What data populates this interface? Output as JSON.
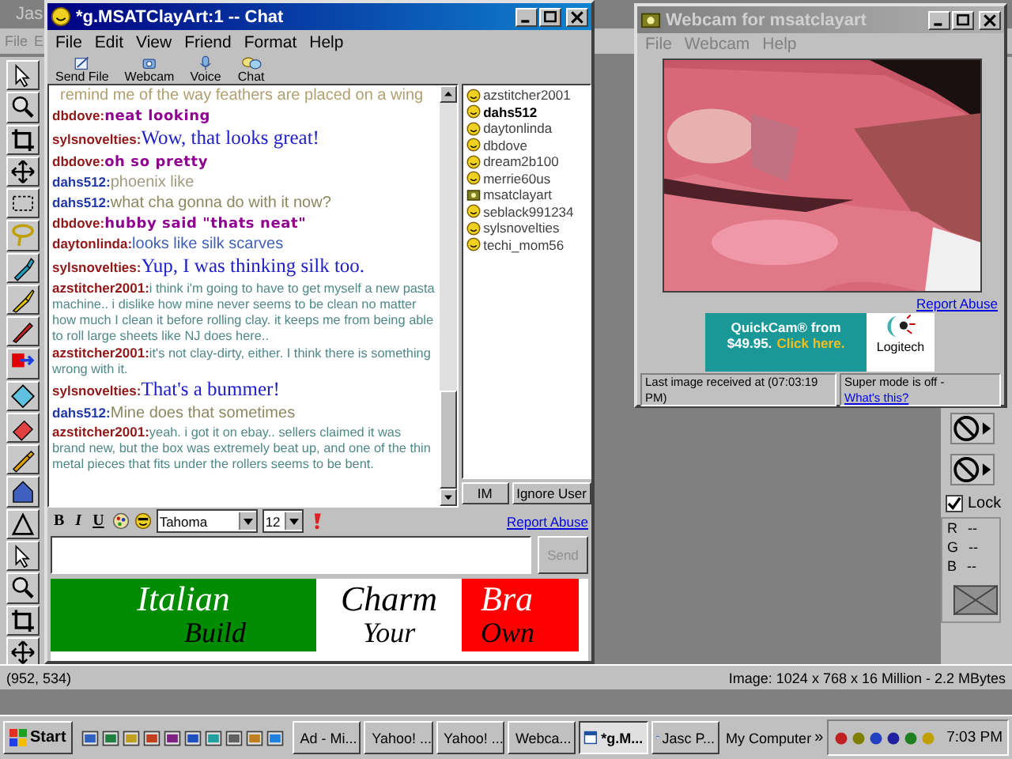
{
  "app": {
    "title": "Jas",
    "menu": [
      "File",
      "E"
    ]
  },
  "chat_window": {
    "title": "*g.MSATClayArt:1 -- Chat",
    "active": true,
    "menu": [
      "File",
      "Edit",
      "View",
      "Friend",
      "Format",
      "Help"
    ],
    "toolbar": [
      {
        "label": "Send File",
        "kind": "send-file"
      },
      {
        "label": "Webcam",
        "kind": "webcam"
      },
      {
        "label": "Voice",
        "kind": "voice"
      },
      {
        "label": "Chat",
        "kind": "chat"
      }
    ],
    "messages": [
      {
        "text": "remind me of the way feathers are placed on a wing",
        "kind": "sans",
        "color": "#b0a070"
      },
      {
        "sender": {
          "text": "dbdove:",
          "color": "#901818"
        },
        "text": "neat looking",
        "kind": "heavy",
        "color": "#900090"
      },
      {
        "sender": {
          "text": "sylsnovelties:",
          "color": "#901818"
        },
        "text": "Wow, that looks great!",
        "kind": "serif",
        "color": "#2020c8"
      },
      {
        "sender": {
          "text": "dbdove:",
          "color": "#901818"
        },
        "text": "oh so pretty",
        "kind": "heavy",
        "color": "#900090"
      },
      {
        "sender": {
          "text": "dahs512:",
          "color": "#2038a8"
        },
        "text": "phoenix like",
        "kind": "sans",
        "color": "#a09c80"
      },
      {
        "sender": {
          "text": "dahs512:",
          "color": "#2038a8"
        },
        "text": "what cha gonna do with it now?",
        "kind": "sans",
        "color": "#8c8860"
      },
      {
        "sender": {
          "text": "dbdove:",
          "color": "#901818"
        },
        "text": "hubby said \"thats neat\"",
        "kind": "heavy",
        "color": "#900090"
      },
      {
        "sender": {
          "text": "daytonlinda:",
          "color": "#901818"
        },
        "text": "looks like silk scarves",
        "kind": "sans",
        "color": "#4060b8"
      },
      {
        "sender": {
          "text": "sylsnovelties:",
          "color": "#901818"
        },
        "text": "Yup, I was thinking silk too.",
        "kind": "serif",
        "color": "#2020c8"
      },
      {
        "sender": {
          "text": "azstitcher2001:",
          "color": "#901818"
        },
        "text": "i think i'm going to have to get myself a new pasta machine.. i dislike how mine never seems to be clean no matter how much I clean it before rolling clay. it keeps me from being able to roll large sheets like NJ does here..",
        "kind": "comic",
        "color": "#508888"
      },
      {
        "sender": {
          "text": "azstitcher2001:",
          "color": "#901818"
        },
        "text": "it's not clay-dirty, either. I think there is something wrong with it.",
        "kind": "comic",
        "color": "#508888"
      },
      {
        "sender": {
          "text": "sylsnovelties:",
          "color": "#901818"
        },
        "text": "That's a bummer!",
        "kind": "serif",
        "color": "#2020c8"
      },
      {
        "sender": {
          "text": "dahs512:",
          "color": "#2038a8"
        },
        "text": "Mine does that sometimes",
        "kind": "sans",
        "color": "#8c8860"
      },
      {
        "sender": {
          "text": "azstitcher2001:",
          "color": "#901818"
        },
        "text": "yeah. i got it on ebay.. sellers claimed it was brand new, but the box was extremely beat up, and one of the thin metal pieces that fits under the rollers seems to be bent.",
        "kind": "comic",
        "color": "#508888"
      }
    ],
    "users": [
      {
        "name": "azstitcher2001",
        "bold": false,
        "kind": "smiley"
      },
      {
        "name": "dahs512",
        "bold": true,
        "kind": "smiley"
      },
      {
        "name": "daytonlinda",
        "bold": false,
        "kind": "smiley"
      },
      {
        "name": "dbdove",
        "bold": false,
        "kind": "smiley"
      },
      {
        "name": "dream2b100",
        "bold": false,
        "kind": "smiley"
      },
      {
        "name": "merrie60us",
        "bold": false,
        "kind": "smiley"
      },
      {
        "name": "msatclayart",
        "bold": false,
        "kind": "webcam"
      },
      {
        "name": "seblack991234",
        "bold": false,
        "kind": "smiley"
      },
      {
        "name": "sylsnovelties",
        "bold": false,
        "kind": "smiley"
      },
      {
        "name": "techi_mom56",
        "bold": false,
        "kind": "smiley"
      }
    ],
    "user_buttons": [
      "IM",
      "Ignore User"
    ],
    "format_bar": {
      "buttons": [
        "B",
        "I",
        "U"
      ],
      "font": "Tahoma",
      "size": "12",
      "report_link": "Report Abuse"
    },
    "send_button": {
      "label": "Send",
      "disabled": true
    },
    "banner": [
      {
        "top": {
          "text": "Italian",
          "color": "#ffffff"
        },
        "bottom": "Build",
        "color": "#008c00"
      },
      {
        "top": {
          "text": "Charm",
          "color": "#000000"
        },
        "bottom": "Your",
        "color": "#ffffff"
      },
      {
        "top": {
          "text": "Bra",
          "color": "#ffffff"
        },
        "bottom": "Own",
        "color": "#ff0000"
      }
    ]
  },
  "webcam_window": {
    "title": "Webcam for msatclayart",
    "active": false,
    "menu": [
      "File",
      "Webcam",
      "Help"
    ],
    "report_link": "Report Abuse",
    "ad": {
      "line1": "QuickCam® from",
      "price": "$49.95.",
      "link": "Click here.",
      "brand": "Logitech"
    },
    "status": "Last image received at (07:03:19 PM)",
    "mode": "Super mode is off -",
    "mode_link": "What's this?"
  },
  "palette": {
    "lock": {
      "label": "Lock",
      "checked": true
    },
    "channels": [
      "R --",
      "G --",
      "B --"
    ]
  },
  "status_bar": {
    "position": "(952, 534)",
    "image_info": "Image: 1024 x 768 x 16 Million - 2.2 MBytes"
  },
  "taskbar": {
    "start": "Start",
    "tasks": [
      {
        "label": "Ad - Mi...",
        "selected": false
      },
      {
        "label": "Yahoo! ...",
        "selected": false
      },
      {
        "label": "Yahoo! ...",
        "selected": false
      },
      {
        "label": "Webca...",
        "selected": false
      },
      {
        "label": "*g.M...",
        "selected": true
      },
      {
        "label": "Jasc P...",
        "selected": false
      }
    ],
    "address": "My Computer",
    "more": "»",
    "clock": "7:03 PM"
  }
}
